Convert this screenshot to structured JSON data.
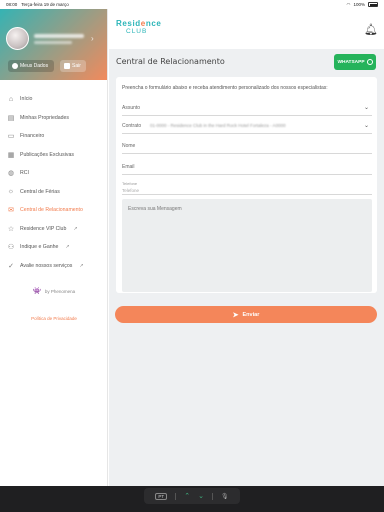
{
  "status_bar": {
    "time": "08:00",
    "date": "Terça-feira 19 de março",
    "battery": "100%"
  },
  "sidebar": {
    "buttons": {
      "my_data": "Meus Dados",
      "exit": "Sair"
    },
    "items": [
      {
        "label": "Início",
        "icon": "home-icon",
        "active": false
      },
      {
        "label": "Minhas Propriedades",
        "icon": "document-icon",
        "active": false
      },
      {
        "label": "Financeiro",
        "icon": "wallet-icon",
        "active": false
      },
      {
        "label": "Publicações Exclusivas",
        "icon": "newspaper-icon",
        "active": false
      },
      {
        "label": "RCI",
        "icon": "globe-icon",
        "active": false
      },
      {
        "label": "Central de Férias",
        "icon": "sun-icon",
        "active": false
      },
      {
        "label": "Central de Relacionamento",
        "icon": "mail-icon",
        "active": true
      },
      {
        "label": "Residence VIP Club",
        "icon": "star-icon",
        "active": false,
        "external": true
      },
      {
        "label": "Indique e Ganhe",
        "icon": "people-icon",
        "active": false,
        "external": true
      },
      {
        "label": "Avalie nossos serviços",
        "icon": "check-icon",
        "active": false,
        "external": true
      }
    ],
    "powered_by": "by Phenomena",
    "privacy_policy": "Política de Privacidade"
  },
  "topbar": {
    "logo_line1_a": "Resid",
    "logo_line1_b": "e",
    "logo_line1_c": "nce",
    "logo_line2": "CLUB"
  },
  "page": {
    "title": "Central de Relacionamento",
    "whatsapp_label": "WHATSAPP",
    "intro": "Preencha o formulário abaixo e receba atendimento personalizado dos nossos especialistas:",
    "fields": {
      "subject_label": "Assunto",
      "contract_label": "Contrato",
      "contract_value": "01-0000 - Residence Club in the Hard Rock Hotel Fortaleza - A0000",
      "name_placeholder": "Nome",
      "email_placeholder": "Email",
      "phone_label": "Telefone",
      "phone_placeholder": "Telefone",
      "message_placeholder": "Escreva sua Mensagem"
    },
    "send_label": "Enviar"
  },
  "keyboard_bar": {
    "key_label": "PT"
  },
  "colors": {
    "accent_orange": "#f27b4c",
    "brand_teal": "#2bb5b8",
    "whatsapp_green": "#25b35b"
  }
}
